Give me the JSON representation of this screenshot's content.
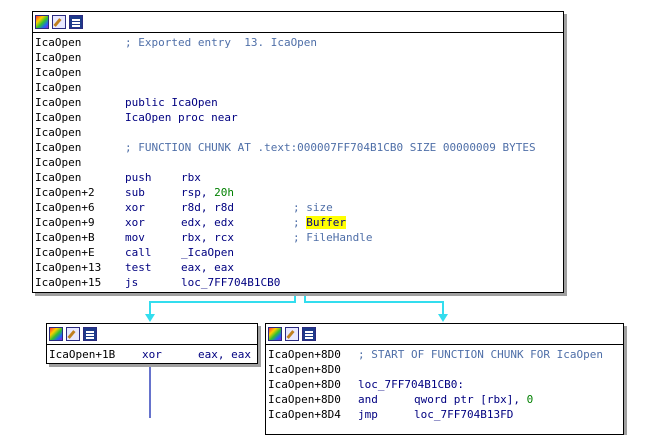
{
  "main_node": {
    "lines": [
      {
        "addr": "IcaOpen",
        "text": "; Exported entry  13. IcaOpen",
        "kind": "comment"
      },
      {
        "addr": "IcaOpen",
        "text": "",
        "kind": "blank"
      },
      {
        "addr": "IcaOpen",
        "text": "",
        "kind": "blank"
      },
      {
        "addr": "IcaOpen",
        "text": "",
        "kind": "blank"
      },
      {
        "addr": "IcaOpen",
        "text": "public IcaOpen",
        "kind": "code"
      },
      {
        "addr": "IcaOpen",
        "text": "IcaOpen proc near",
        "kind": "code"
      },
      {
        "addr": "IcaOpen",
        "text": "",
        "kind": "blank"
      },
      {
        "addr": "IcaOpen",
        "text": "; FUNCTION CHUNK AT .text:000007FF704B1CB0 SIZE 00000009 BYTES",
        "kind": "comment"
      },
      {
        "addr": "IcaOpen",
        "text": "",
        "kind": "blank"
      }
    ],
    "instr": [
      {
        "addr": "IcaOpen",
        "mnemonic": "push",
        "operands": "rbx",
        "comment": ""
      },
      {
        "addr": "IcaOpen+2",
        "mnemonic": "sub",
        "operands": "rsp, ",
        "num": "20h",
        "comment": ""
      },
      {
        "addr": "IcaOpen+6",
        "mnemonic": "xor",
        "operands": "r8d, r8d",
        "comment": "; size"
      },
      {
        "addr": "IcaOpen+9",
        "mnemonic": "xor",
        "operands": "edx, edx",
        "comment": "; ",
        "highlight": "Buffer"
      },
      {
        "addr": "IcaOpen+B",
        "mnemonic": "mov",
        "operands": "rbx, rcx",
        "comment": "; FileHandle"
      },
      {
        "addr": "IcaOpen+E",
        "mnemonic": "call",
        "operands": "_IcaOpen",
        "comment": ""
      },
      {
        "addr": "IcaOpen+13",
        "mnemonic": "test",
        "operands": "eax, eax",
        "comment": ""
      },
      {
        "addr": "IcaOpen+15",
        "mnemonic": "js",
        "operands": "loc_7FF704B1CB0",
        "comment": ""
      }
    ]
  },
  "left_node": {
    "addr": "IcaOpen+1B",
    "mnemonic": "xor",
    "operands": "eax, eax"
  },
  "right_node": {
    "lines": [
      {
        "addr": "IcaOpen+8D0",
        "text": "; START OF FUNCTION CHUNK FOR IcaOpen",
        "kind": "comment"
      },
      {
        "addr": "IcaOpen+8D0",
        "text": "",
        "kind": "blank"
      },
      {
        "addr": "IcaOpen+8D0",
        "text": "loc_7FF704B1CB0:",
        "kind": "code"
      }
    ],
    "instr": [
      {
        "addr": "IcaOpen+8D0",
        "mnemonic": "and",
        "operands": "qword ptr [rbx], ",
        "num": "0"
      },
      {
        "addr": "IcaOpen+8D4",
        "mnemonic": "jmp",
        "operands": "loc_7FF704B13FD"
      }
    ]
  },
  "colors": {
    "edge": "#33ddee",
    "edge_left": "#3344bb",
    "mnemonic": "#000080",
    "comment": "#4f6fa8",
    "highlight": "#ffff00",
    "number": "#008000"
  }
}
